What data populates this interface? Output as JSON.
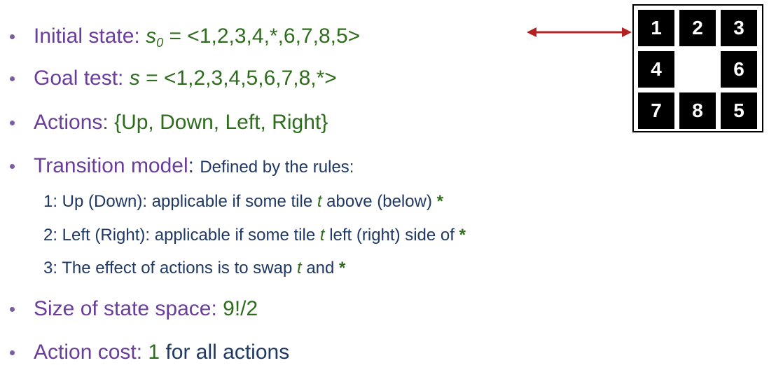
{
  "bullets": {
    "initial": {
      "label": "Initial state:",
      "var": "s",
      "subscript": "0",
      "value": "= <1,2,3,4,*,6,7,8,5>"
    },
    "goal": {
      "label": "Goal test:",
      "var": "s",
      "value": "= <1,2,3,4,5,6,7,8,*>"
    },
    "actions": {
      "label": "Actions:",
      "value": "{Up, Down, Left, Right}"
    },
    "transition": {
      "label": "Transition model",
      "colon": ":",
      "value": "Defined by the rules:"
    },
    "size": {
      "label": "Size of state space:",
      "value": "9!/2"
    },
    "cost": {
      "label": "Action cost:",
      "value_num": "1",
      "value_rest": "for all actions"
    }
  },
  "rules": [
    {
      "pre": "1: Up (Down): applicable if some tile ",
      "t": "t",
      "post": " above (below) ",
      "star": "*"
    },
    {
      "pre": "2: Left (Right): applicable if some tile ",
      "t": "t",
      "post": " left (right) side of ",
      "star": "*"
    },
    {
      "pre": "3: The effect of actions is to swap ",
      "t": "t",
      "post": " and ",
      "star": "*"
    }
  ],
  "puzzle": {
    "tiles": [
      "1",
      "2",
      "3",
      "4",
      "",
      "6",
      "7",
      "8",
      "5"
    ]
  },
  "colors": {
    "purple": "#6a3d99",
    "green": "#2f6d1e",
    "navy": "#1f3864",
    "arrow": "#b22222"
  },
  "icons": {
    "arrow": "double-headed-arrow-icon"
  }
}
